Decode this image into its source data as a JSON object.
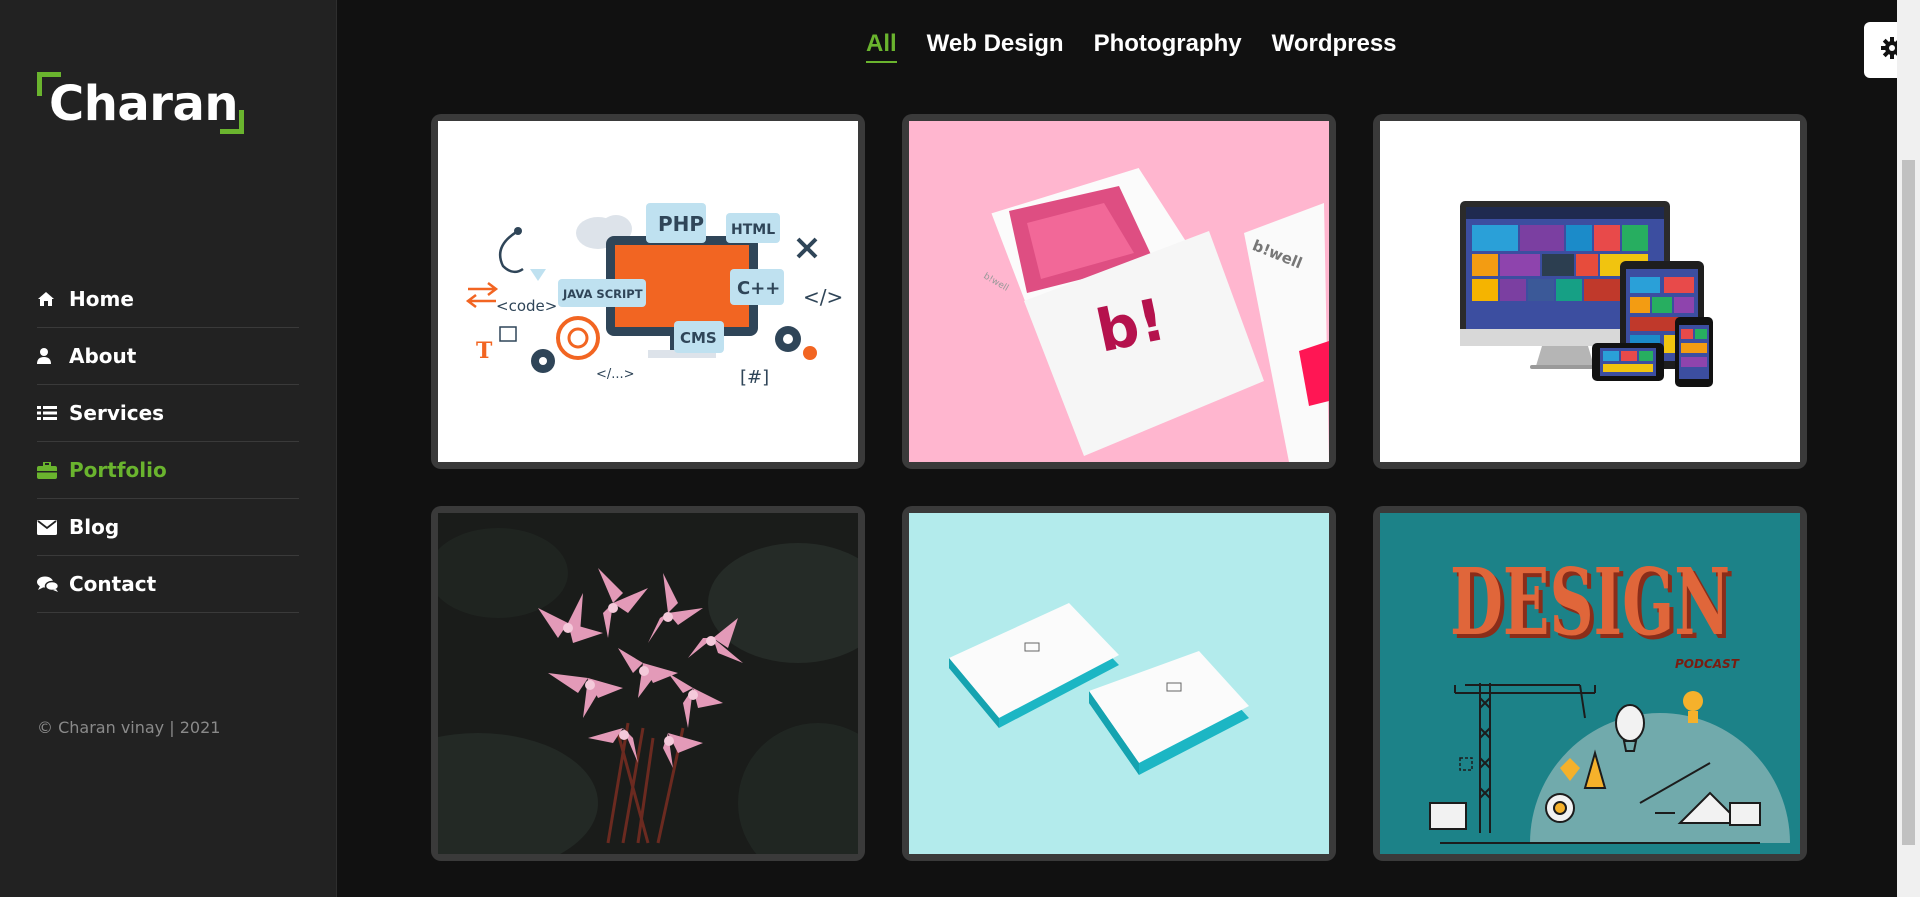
{
  "brand": {
    "name": "Charan",
    "accent": "#6ab42e"
  },
  "nav": [
    {
      "label": "Home",
      "icon": "home-icon",
      "active": false
    },
    {
      "label": "About",
      "icon": "user-icon",
      "active": false
    },
    {
      "label": "Services",
      "icon": "list-icon",
      "active": false
    },
    {
      "label": "Portfolio",
      "icon": "briefcase-icon",
      "active": true
    },
    {
      "label": "Blog",
      "icon": "envelope-icon",
      "active": false
    },
    {
      "label": "Contact",
      "icon": "chat-icon",
      "active": false
    }
  ],
  "copyright": "© Charan vinay | 2021",
  "filters": [
    {
      "label": "All",
      "active": true
    },
    {
      "label": "Web Design",
      "active": false
    },
    {
      "label": "Photography",
      "active": false
    },
    {
      "label": "Wordpress",
      "active": false
    }
  ],
  "portfolio": [
    {
      "subject": "web-development-illustration",
      "labels": [
        "PHP",
        "HTML",
        "C++",
        "JAVA SCRIPT",
        "CMS",
        "<code>",
        "</>",
        "</...>",
        "[#]",
        "T"
      ]
    },
    {
      "subject": "bwell-stationery-mockup",
      "labels": [
        "b!",
        "b!well",
        "b!well"
      ]
    },
    {
      "subject": "responsive-devices-mockup",
      "labels": []
    },
    {
      "subject": "pink-flower-photo",
      "labels": []
    },
    {
      "subject": "business-cards-mockup",
      "labels": []
    },
    {
      "subject": "design-podcast-poster",
      "labels": [
        "DESIGN",
        "PODCAST"
      ]
    }
  ],
  "settings": {
    "icon": "gear-icon"
  }
}
